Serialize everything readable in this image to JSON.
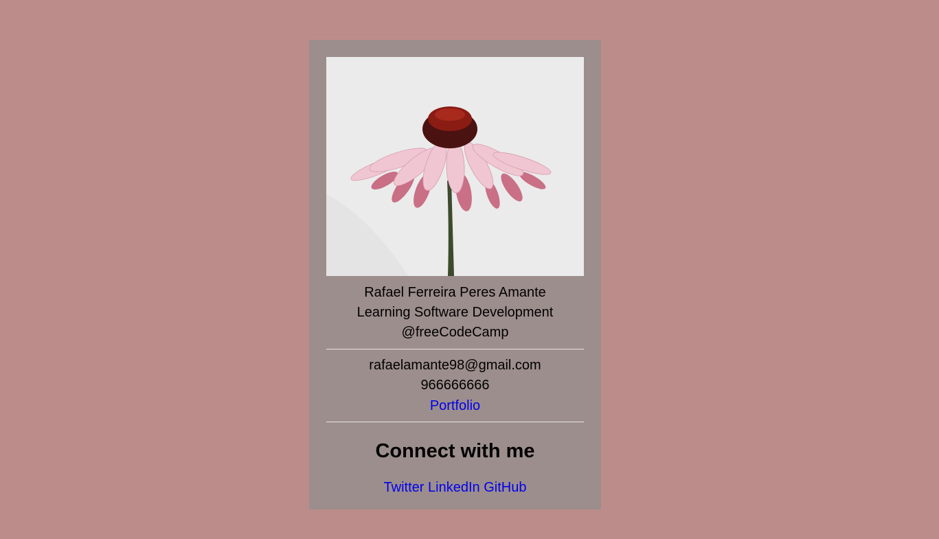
{
  "profile": {
    "image_subject": "pink coneflower (echinacea) on white background",
    "name": "Rafael Ferreira Peres Amante",
    "role": "Learning Software Development",
    "handle": "@freeCodeCamp"
  },
  "contact": {
    "email": "rafaelamante98@gmail.com",
    "phone": "966666666",
    "portfolio_label": "Portfolio"
  },
  "connect": {
    "heading": "Connect with me",
    "links": [
      "Twitter",
      "LinkedIn",
      "GitHub"
    ]
  },
  "colors": {
    "page_background": "#bc8c8b",
    "card_background": "#9c8e8c",
    "link": "#0000ee"
  }
}
